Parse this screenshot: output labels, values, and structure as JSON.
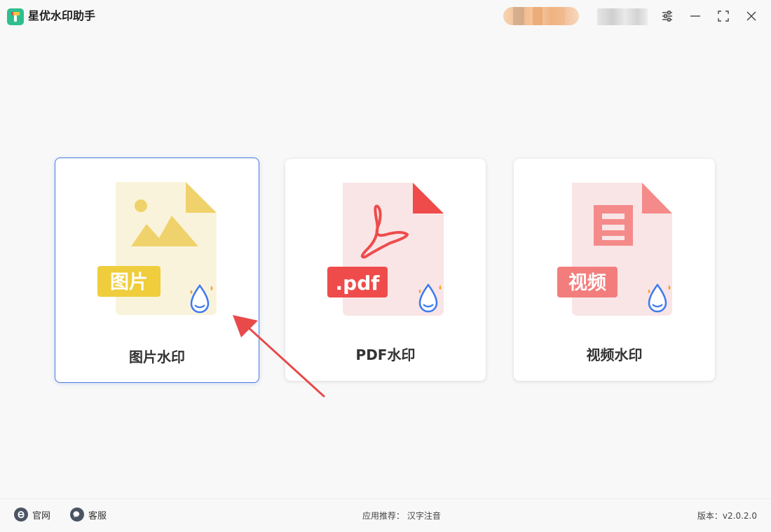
{
  "app": {
    "title": "星优水印助手"
  },
  "cards": [
    {
      "label": "图片水印",
      "badge": "图片"
    },
    {
      "label": "PDF水印",
      "badge": ".pdf"
    },
    {
      "label": "视频水印",
      "badge": "视频"
    }
  ],
  "footer": {
    "site_label": "官网",
    "service_label": "客服",
    "recommend_prefix": "应用推荐：",
    "recommend_app": "汉字注音",
    "version_label": "版本：",
    "version": "v2.0.2.0"
  },
  "colors": {
    "image_accent": "#efd26b",
    "pdf_accent": "#ef4b4b",
    "video_accent": "#f58a8a",
    "selected_border": "#4a7de0",
    "drop_blue": "#3f7bf0",
    "drop_orange": "#f3a33a",
    "arrow": "#e84a4a"
  },
  "icons": {
    "logo": "app-logo-icon",
    "settings": "settings-sliders-icon",
    "minimize": "minimize-icon",
    "maximize": "maximize-icon",
    "close": "close-icon",
    "site": "browser-e-icon",
    "service": "chat-bubble-icon"
  }
}
